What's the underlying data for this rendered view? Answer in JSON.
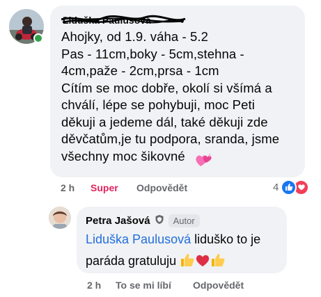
{
  "comment1": {
    "author_name": "Liduška Paulusová",
    "text": "Ahojky, od 1.9. váha - 5.2\nPas - 11cm,boky - 5cm,stehna -\n4cm,paže - 2cm,prsa - 1cm\nCítím se moc dobře, okolí si všímá a\nchválí, lépe se pohybuji, moc Peti\nděkuji a jedeme dál, také děkuji zde\nděvčatům,je tu podpora, sranda, jsme\nvšechny moc šikovné",
    "time": "2 h",
    "reaction_label": "Super",
    "reply_label": "Odpovědět",
    "reaction_count": "4",
    "reaction_color": "#e0245e"
  },
  "reply": {
    "author_name": "Petra Jašová",
    "badge": "Autor",
    "mention": "Liduška Paulusová",
    "text_line1": " liduško to je",
    "text_line2": "paráda gratuluju ",
    "time": "2 h",
    "like_label": "To se mi líbí",
    "reply_label": "Odpovědět"
  },
  "colors": {
    "bubble": "#f0f2f5",
    "mention": "#216fdb",
    "like": "#1877f2",
    "love": "#f33e58",
    "online": "#31a24c"
  },
  "icons": [
    "online-status-icon",
    "sparkling-heart-emoji",
    "like-reaction-icon",
    "love-reaction-icon",
    "shield-icon",
    "thumbs-up-emoji",
    "red-heart-emoji"
  ]
}
